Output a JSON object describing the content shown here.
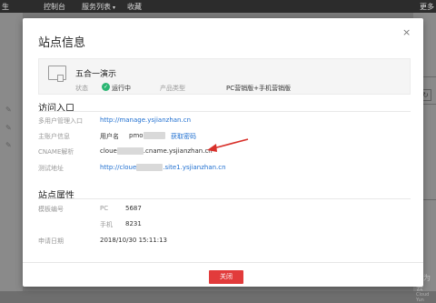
{
  "topbar": {
    "left_text": "生",
    "item1": "控制台",
    "item2": "服务列表",
    "item3": "收藏",
    "right_text": "更多"
  },
  "modal": {
    "title": "站点信息",
    "close_glyph": "×",
    "site": {
      "name": "五合一演示",
      "status_label": "状态",
      "status_value": "运行中",
      "type_label": "产品类型",
      "type_value": "PC营销版+手机营销版"
    },
    "access": {
      "heading": "访问入口",
      "rows": [
        {
          "label": "多用户管理入口",
          "value": "http://manage.ysjianzhan.cn"
        },
        {
          "label": "主账户信息",
          "user_label": "用户名",
          "user_value": "pmo",
          "action": "获取密码"
        },
        {
          "label": "CNAME解析",
          "value_prefix": "cloue",
          "value_suffix": ".cname.ysjianzhan.cn"
        },
        {
          "label": "测试地址",
          "value_prefix": "http://cloue",
          "value_suffix": ".site1.ysjianzhan.cn"
        }
      ]
    },
    "attrs": {
      "heading": "站点属性",
      "template_label": "模板编号",
      "pc_label": "PC",
      "pc_value": "5687",
      "mobile_label": "手机",
      "mobile_value": "8231",
      "date_label": "申请日期",
      "date_value": "2018/10/30 15:11:13"
    },
    "close_button": "关闭"
  },
  "watermark": {
    "brand": "华为云",
    "sub": "Cloud Yun"
  },
  "colors": {
    "accent": "#e23b3b",
    "link": "#1f6fd0",
    "status": "#2bb673"
  }
}
